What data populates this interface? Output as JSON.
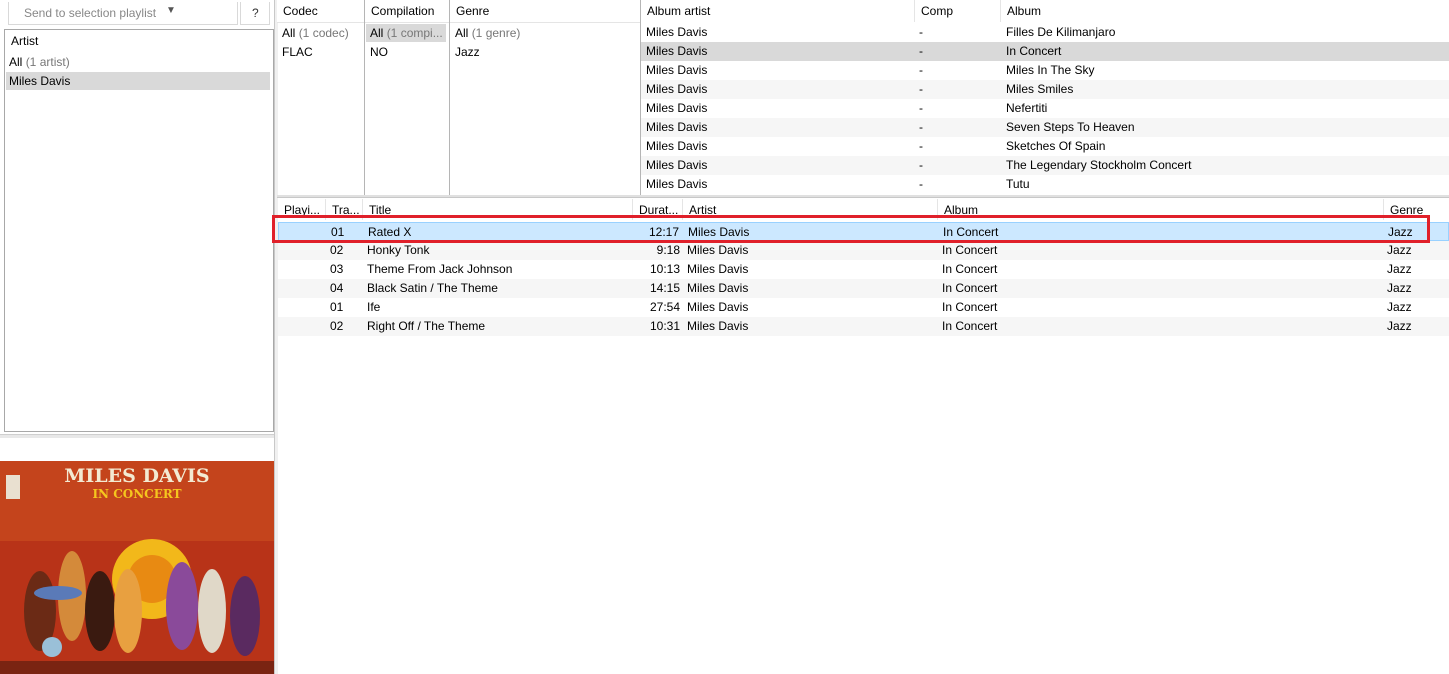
{
  "left": {
    "send_playlist_label": "Send to selection playlist",
    "help_label": "?",
    "artist_header": "Artist",
    "artists": [
      {
        "name": "All",
        "count": "(1 artist)"
      },
      {
        "name": "Miles Davis",
        "count": ""
      }
    ],
    "album_art": {
      "title": "MILES DAVIS",
      "subtitle": "IN CONCERT"
    }
  },
  "filters": {
    "codec": {
      "header": "Codec",
      "rows": [
        {
          "name": "All",
          "count": "(1 codec)"
        },
        {
          "name": "FLAC",
          "count": ""
        }
      ]
    },
    "compilation": {
      "header": "Compilation",
      "rows": [
        {
          "name": "All",
          "count": "(1 compi..."
        },
        {
          "name": "NO",
          "count": ""
        }
      ]
    },
    "genre": {
      "header": "Genre",
      "rows": [
        {
          "name": "All",
          "count": "(1 genre)"
        },
        {
          "name": "Jazz",
          "count": ""
        }
      ]
    }
  },
  "albums": {
    "headers": {
      "album_artist": "Album artist",
      "comp": "Comp",
      "album": "Album"
    },
    "rows": [
      {
        "artist": "Miles Davis",
        "comp": "-",
        "album": "Filles De Kilimanjaro"
      },
      {
        "artist": "Miles Davis",
        "comp": "-",
        "album": "In Concert"
      },
      {
        "artist": "Miles Davis",
        "comp": "-",
        "album": "Miles In The Sky"
      },
      {
        "artist": "Miles Davis",
        "comp": "-",
        "album": "Miles Smiles"
      },
      {
        "artist": "Miles Davis",
        "comp": "-",
        "album": "Nefertiti"
      },
      {
        "artist": "Miles Davis",
        "comp": "-",
        "album": "Seven Steps To Heaven"
      },
      {
        "artist": "Miles Davis",
        "comp": "-",
        "album": "Sketches Of Spain"
      },
      {
        "artist": "Miles Davis",
        "comp": "-",
        "album": "The Legendary Stockholm Concert"
      },
      {
        "artist": "Miles Davis",
        "comp": "-",
        "album": "Tutu"
      }
    ]
  },
  "tracks": {
    "headers": {
      "playing": "Playi...",
      "track": "Tra...",
      "title": "Title",
      "duration": "Durat...",
      "artist": "Artist",
      "album": "Album",
      "genre": "Genre"
    },
    "rows": [
      {
        "track": "01",
        "title": "Rated X",
        "duration": "12:17",
        "artist": "Miles Davis",
        "album": "In Concert",
        "genre": "Jazz"
      },
      {
        "track": "02",
        "title": "Honky Tonk",
        "duration": "9:18",
        "artist": "Miles Davis",
        "album": "In Concert",
        "genre": "Jazz"
      },
      {
        "track": "03",
        "title": "Theme From Jack Johnson",
        "duration": "10:13",
        "artist": "Miles Davis",
        "album": "In Concert",
        "genre": "Jazz"
      },
      {
        "track": "04",
        "title": "Black Satin / The Theme",
        "duration": "14:15",
        "artist": "Miles Davis",
        "album": "In Concert",
        "genre": "Jazz"
      },
      {
        "track": "01",
        "title": "Ife",
        "duration": "27:54",
        "artist": "Miles Davis",
        "album": "In Concert",
        "genre": "Jazz"
      },
      {
        "track": "02",
        "title": "Right Off / The Theme",
        "duration": "10:31",
        "artist": "Miles Davis",
        "album": "In Concert",
        "genre": "Jazz"
      }
    ]
  },
  "colors": {
    "selection": "#cce8ff",
    "highlight_box": "#e0202a",
    "album_art_bg": "#b83318"
  }
}
